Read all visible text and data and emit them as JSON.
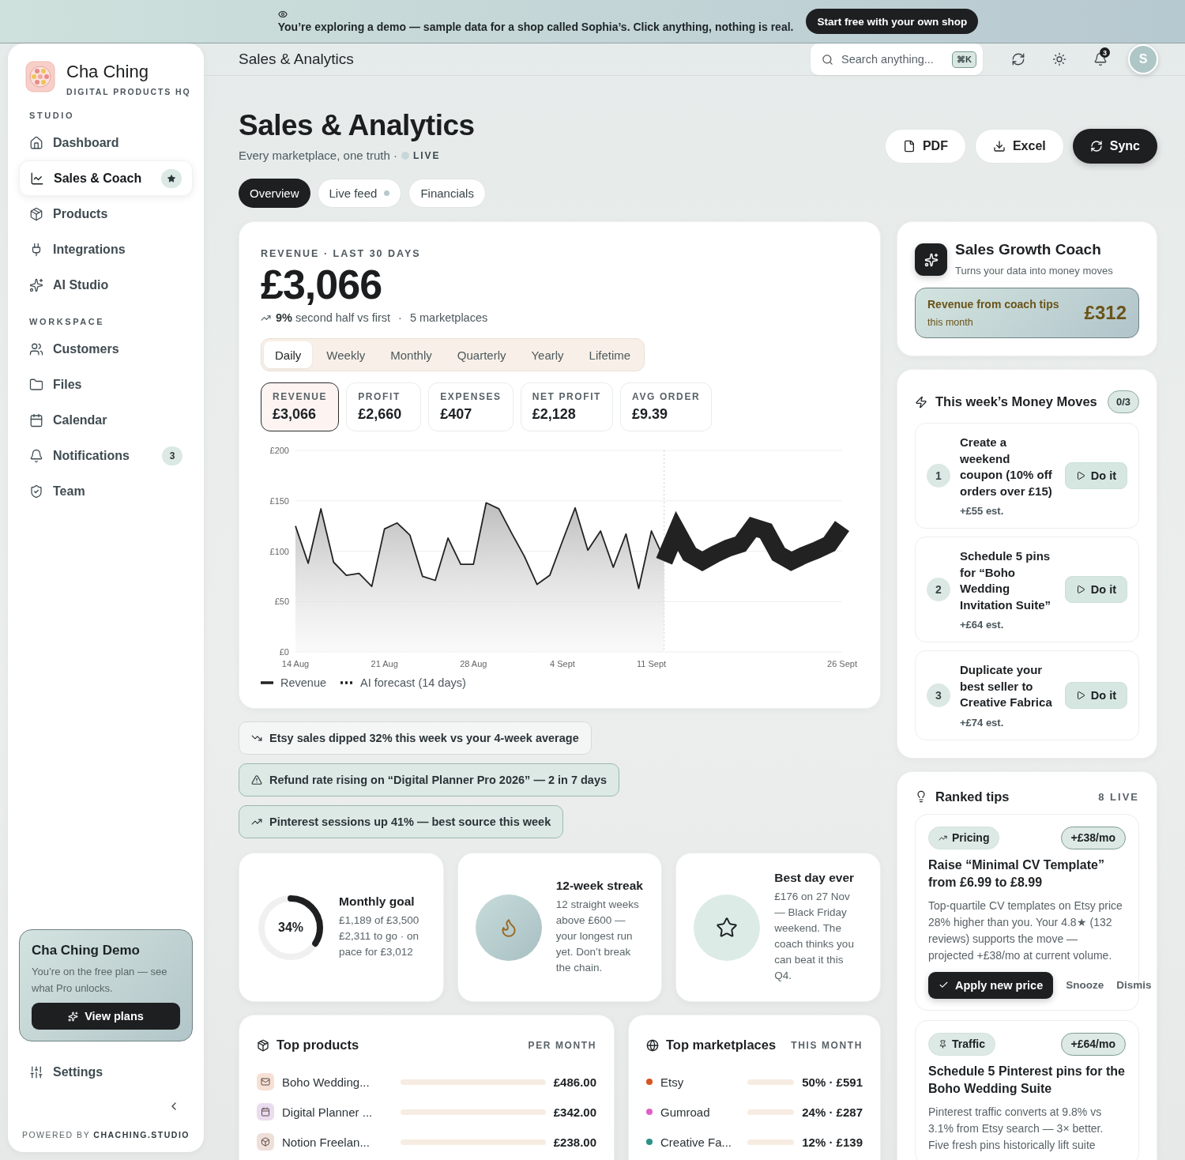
{
  "banner": {
    "text": "You’re exploring a demo — sample data for a shop called Sophia’s. Click anything, nothing is real.",
    "button": "Start free with your own shop"
  },
  "brand": {
    "name": "Cha Ching",
    "tagline": "DIGITAL PRODUCTS HQ"
  },
  "sidebar": {
    "sections": [
      {
        "title": "STUDIO",
        "items": [
          {
            "label": "Dashboard",
            "selected": false,
            "starred": false
          },
          {
            "label": "Sales & Coach",
            "selected": true,
            "starred": true
          },
          {
            "label": "Products",
            "selected": false,
            "starred": false
          },
          {
            "label": "Integrations",
            "selected": false,
            "starred": false
          },
          {
            "label": "AI Studio",
            "selected": false,
            "starred": false
          }
        ]
      },
      {
        "title": "WORKSPACE",
        "items": [
          {
            "label": "Customers",
            "selected": false,
            "starred": false
          },
          {
            "label": "Files",
            "selected": false,
            "starred": false
          },
          {
            "label": "Calendar",
            "selected": false,
            "starred": false
          },
          {
            "label": "Notifications",
            "selected": false,
            "starred": false,
            "badge": "3"
          },
          {
            "label": "Team",
            "selected": false,
            "starred": false
          }
        ]
      }
    ],
    "upgrade": {
      "title": "Cha Ching Demo",
      "text": "You’re on the free plan — see what Pro unlocks.",
      "button": "View plans"
    },
    "settings": "Settings",
    "footer": "POWERED BY **CHACHING.STUDIO**"
  },
  "header": {
    "title": "Sales & Analytics",
    "search_placeholder": "Search anything...",
    "shortcut": "⌘K",
    "notification_count": "3",
    "avatar": "S"
  },
  "page": {
    "title": "Sales & Analytics",
    "subtitle": "Every marketplace, one truth ·",
    "live": "LIVE",
    "actions": [
      {
        "label": "PDF",
        "primary": false
      },
      {
        "label": "Excel",
        "primary": false
      },
      {
        "label": "Sync",
        "primary": true
      }
    ]
  },
  "view_tabs": [
    {
      "label": "Overview",
      "selected": true,
      "live": false
    },
    {
      "label": "Live feed",
      "selected": false,
      "live": true
    },
    {
      "label": "Financials",
      "selected": false,
      "live": false
    }
  ],
  "revenue": {
    "label": "REVENUE · LAST 30 DAYS",
    "amount": "£3,066",
    "trend": "**9%** second half vs first",
    "separator": "·",
    "marketplaces": "5 marketplaces",
    "periods": [
      {
        "label": "Daily",
        "selected": true
      },
      {
        "label": "Weekly",
        "selected": false
      },
      {
        "label": "Monthly",
        "selected": false
      },
      {
        "label": "Quarterly",
        "selected": false
      },
      {
        "label": "Yearly",
        "selected": false
      },
      {
        "label": "Lifetime",
        "selected": false
      }
    ],
    "metrics": [
      {
        "label": "REVENUE",
        "value": "£3,066",
        "selected": true
      },
      {
        "label": "PROFIT",
        "value": "£2,660",
        "selected": false
      },
      {
        "label": "EXPENSES",
        "value": "£407",
        "selected": false
      },
      {
        "label": "NET PROFIT",
        "value": "£2,128",
        "selected": false
      },
      {
        "label": "AVG ORDER",
        "value": "£9.39",
        "selected": false
      }
    ],
    "chart_data": {
      "type": "area",
      "categories": [
        "14 Aug",
        null,
        null,
        null,
        null,
        null,
        null,
        "21 Aug",
        null,
        null,
        null,
        null,
        null,
        null,
        "28 Aug",
        null,
        null,
        null,
        null,
        null,
        null,
        "4 Sept",
        null,
        null,
        null,
        null,
        null,
        null,
        "11 Sept",
        null,
        null,
        null,
        null,
        null,
        null,
        null,
        null,
        null,
        null,
        null,
        null,
        null,
        null,
        "26 Sept"
      ],
      "series": [
        {
          "name": "Revenue",
          "type": "area",
          "color": "#222222",
          "values": [
            125,
            88,
            142,
            89,
            76,
            78,
            65,
            122,
            128,
            116,
            75,
            71,
            113,
            87,
            87,
            148,
            142,
            118,
            95,
            67,
            76,
            110,
            143,
            101,
            120,
            84,
            117,
            63,
            120,
            92,
            null,
            null,
            null,
            null,
            null,
            null,
            null,
            null,
            null,
            null,
            null,
            null,
            null,
            null
          ]
        },
        {
          "name": "AI forecast (14 days)",
          "type": "line",
          "color": "#222222",
          "values": [
            null,
            null,
            null,
            null,
            null,
            null,
            null,
            null,
            null,
            null,
            null,
            null,
            null,
            null,
            null,
            null,
            null,
            null,
            null,
            null,
            null,
            null,
            null,
            null,
            null,
            null,
            null,
            null,
            null,
            90,
            120,
            97,
            90,
            97,
            103,
            107,
            124,
            120,
            97,
            90,
            96,
            101,
            107,
            125
          ]
        }
      ],
      "grid": true,
      "ylim": [
        0,
        200
      ],
      "yticks": [
        {
          "value": 0,
          "label": "£0"
        },
        {
          "value": 50,
          "label": "£50"
        },
        {
          "value": 100,
          "label": "£100"
        },
        {
          "value": 150,
          "label": "£150"
        },
        {
          "value": 200,
          "label": "£200"
        }
      ]
    }
  },
  "alerts": [
    {
      "kind": "down",
      "text": "Etsy sales dipped 32% this week vs your 4-week average"
    },
    {
      "kind": "warning",
      "text": "Refund rate rising on “Digital Planner Pro 2026” — 2 in 7 days"
    },
    {
      "kind": "up",
      "text": "Pinterest sessions up 41% — best source this week"
    }
  ],
  "stats": [
    {
      "kind": "ring",
      "level": 0.34,
      "value": "34%",
      "title": "Monthly goal",
      "text": "£1,189 of £3,500 £2,311 to go · on pace for £3,012"
    },
    {
      "kind": "flame",
      "title": "12-week streak",
      "text": "12 straight weeks above £600 — your longest run yet. Don’t break the chain."
    },
    {
      "kind": "star",
      "title": "Best day ever",
      "text": "£176 on 27 Nov — Black Friday weekend. The coach thinks you can beat it this Q4."
    }
  ],
  "top_products": {
    "title": "Top products",
    "period": "PER MONTH",
    "rows": [
      {
        "kind": "mail",
        "color": "#f6e0d4",
        "name": "Boho Wedding...",
        "value": "£486.00"
      },
      {
        "kind": "calendar",
        "color": "#eadcef",
        "name": "Digital Planner ...",
        "value": "£342.00"
      },
      {
        "kind": "box",
        "color": "#eedfd9",
        "name": "Notion Freelan...",
        "value": "£238.00"
      }
    ]
  },
  "top_marketplaces": {
    "title": "Top marketplaces",
    "period": "THIS MONTH",
    "rows": [
      {
        "color": "#d9531e",
        "name": "Etsy",
        "value": "50% · £591"
      },
      {
        "color": "#e05fc4",
        "name": "Gumroad",
        "value": "24% · £287"
      },
      {
        "color": "#2a9187",
        "name": "Creative Fa...",
        "value": "12% · £139"
      }
    ]
  },
  "coach": {
    "title": "Sales Growth Coach",
    "subtitle": "Turns your data into money moves",
    "earned_label": "Revenue from coach tips",
    "earned_period": "this month",
    "earned": "£312"
  },
  "money_moves": {
    "title": "This week’s Money Moves",
    "progress": "0/3",
    "items": [
      {
        "number": "1",
        "text": "Create a weekend coupon (10% off orders over £15)",
        "estimate": "+£55 est.",
        "button": "Do it"
      },
      {
        "number": "2",
        "text": "Schedule 5 pins for “Boho Wedding Invitation Suite”",
        "estimate": "+£64 est.",
        "button": "Do it"
      },
      {
        "number": "3",
        "text": "Duplicate your best seller to Creative Fabrica",
        "estimate": "+£74 est.",
        "button": "Do it"
      }
    ]
  },
  "ranked_tips": {
    "title": "Ranked tips",
    "count": "8 LIVE",
    "items": [
      {
        "kind": "pricing",
        "category": "Pricing",
        "impact": "+£38/mo",
        "title": "Raise “Minimal CV Template” from £6.99 to £8.99",
        "body": "Top-quartile CV templates on Etsy price 28% higher than you. Your 4.8★ (132 reviews) supports the move — projected +£38/mo at current volume.",
        "actions": [
          "Apply new price",
          "Snooze",
          "Dismis"
        ]
      },
      {
        "kind": "traffic",
        "category": "Traffic",
        "impact": "+£64/mo",
        "title": "Schedule 5 Pinterest pins for the Boho Wedding Suite",
        "body": "Pinterest traffic converts at 9.8% vs 3.1% from Etsy search — 3× better. Five fresh pins historically lift suite"
      }
    ]
  }
}
